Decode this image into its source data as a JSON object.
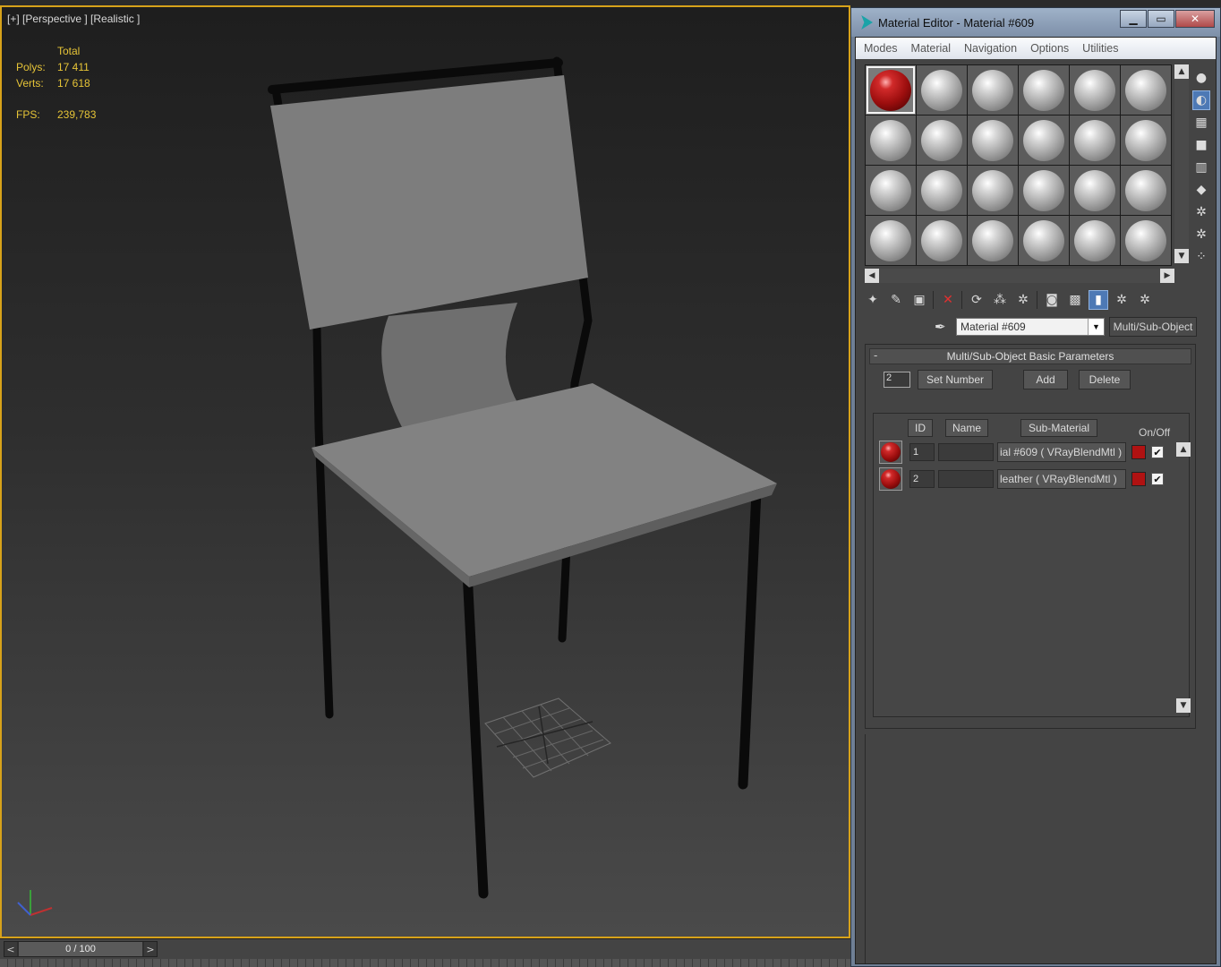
{
  "viewport": {
    "label": "[+] [Perspective ] [Realistic ]",
    "stats": {
      "header": "Total",
      "polys_label": "Polys:",
      "polys_value": "17 411",
      "verts_label": "Verts:",
      "verts_value": "17 618",
      "fps_label": "FPS:",
      "fps_value": "239,783"
    },
    "colors": {
      "border": "#d7a21a",
      "stats_text": "#e6c437"
    }
  },
  "timeline": {
    "prev": "<",
    "next": ">",
    "frame": "0 / 100"
  },
  "material_editor": {
    "title": "Material Editor - Material #609",
    "window_buttons": {
      "minimize": "▁",
      "maximize": "▭",
      "close": "✕"
    },
    "menu": [
      "Modes",
      "Material",
      "Navigation",
      "Options",
      "Utilities"
    ],
    "slot_grid": {
      "rows": 4,
      "cols": 6,
      "active_slot": 0
    },
    "material_name": "Material #609",
    "material_type": "Multi/Sub-Object",
    "rollout": {
      "title": "Multi/Sub-Object Basic Parameters",
      "collapse": "-",
      "count_value": "2",
      "set_number": "Set Number",
      "add": "Add",
      "delete": "Delete",
      "headers": {
        "id": "ID",
        "name": "Name",
        "sub_material": "Sub-Material",
        "on_off": "On/Off"
      },
      "rows": [
        {
          "id": "1",
          "name": "",
          "sub_material": "ial #609  ( VRayBlendMtl )",
          "color": "#b01212",
          "on": "✔"
        },
        {
          "id": "2",
          "name": "",
          "sub_material": "leather   ( VRayBlendMtl )",
          "color": "#b01212",
          "on": "✔"
        }
      ]
    },
    "colors": {
      "accent": "#4d79b5",
      "title_bar": "#9fb2c9"
    }
  }
}
